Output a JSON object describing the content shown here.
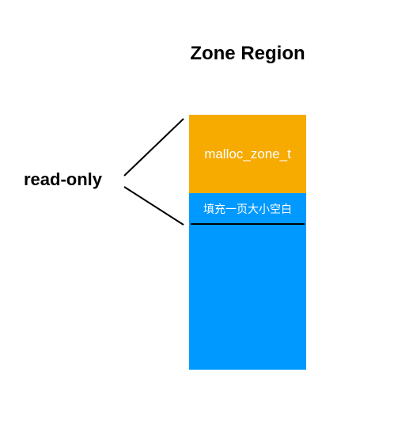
{
  "diagram": {
    "title": "Zone Region",
    "side_label": "read-only",
    "blocks": {
      "header": "malloc_zone_t",
      "padding": "填充一页大小空白",
      "body": ""
    },
    "colors": {
      "header": "#f7aa00",
      "padding": "#0099ff",
      "body": "#0099ff",
      "text_on_block": "#ffffff"
    }
  }
}
